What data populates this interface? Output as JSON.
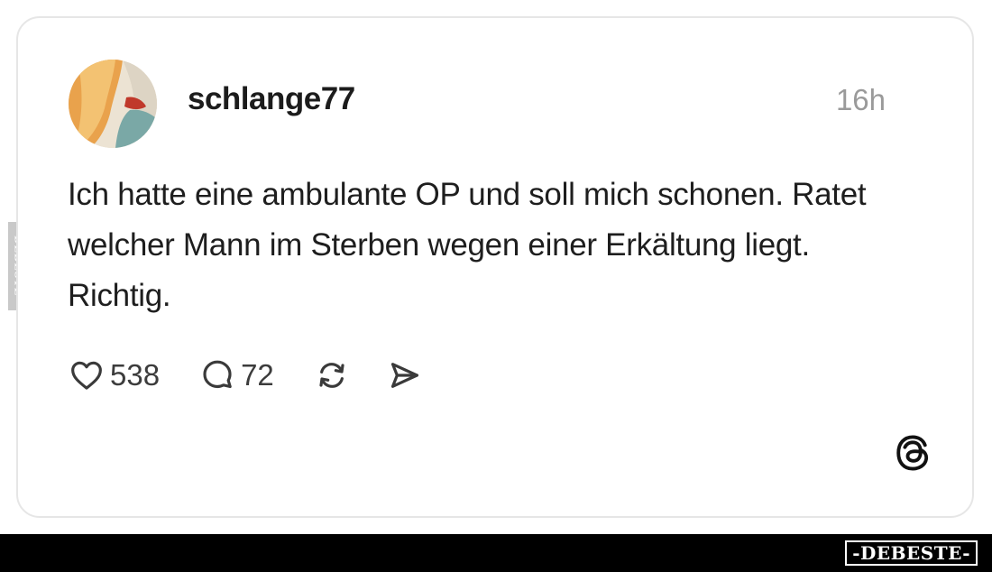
{
  "post": {
    "username": "schlange77",
    "timestamp": "16h",
    "text": "Ich hatte eine ambulante OP und soll mich schonen. Ratet welcher Mann im Sterben wegen einer Erkältung liegt. Richtig.",
    "likes": "538",
    "comments": "72"
  },
  "icons": {
    "like": "heart-icon",
    "comment": "speech-bubble-icon",
    "repost": "repost-icon",
    "share": "send-icon",
    "platform": "threads-logo-icon"
  },
  "watermark": {
    "side_label": "DEBESTE",
    "brand_label": "-DEBESTE-"
  },
  "colors": {
    "text": "#1e1e1e",
    "muted": "#9a9a9a",
    "card_border": "#e6e6e6",
    "footer": "#000000"
  }
}
